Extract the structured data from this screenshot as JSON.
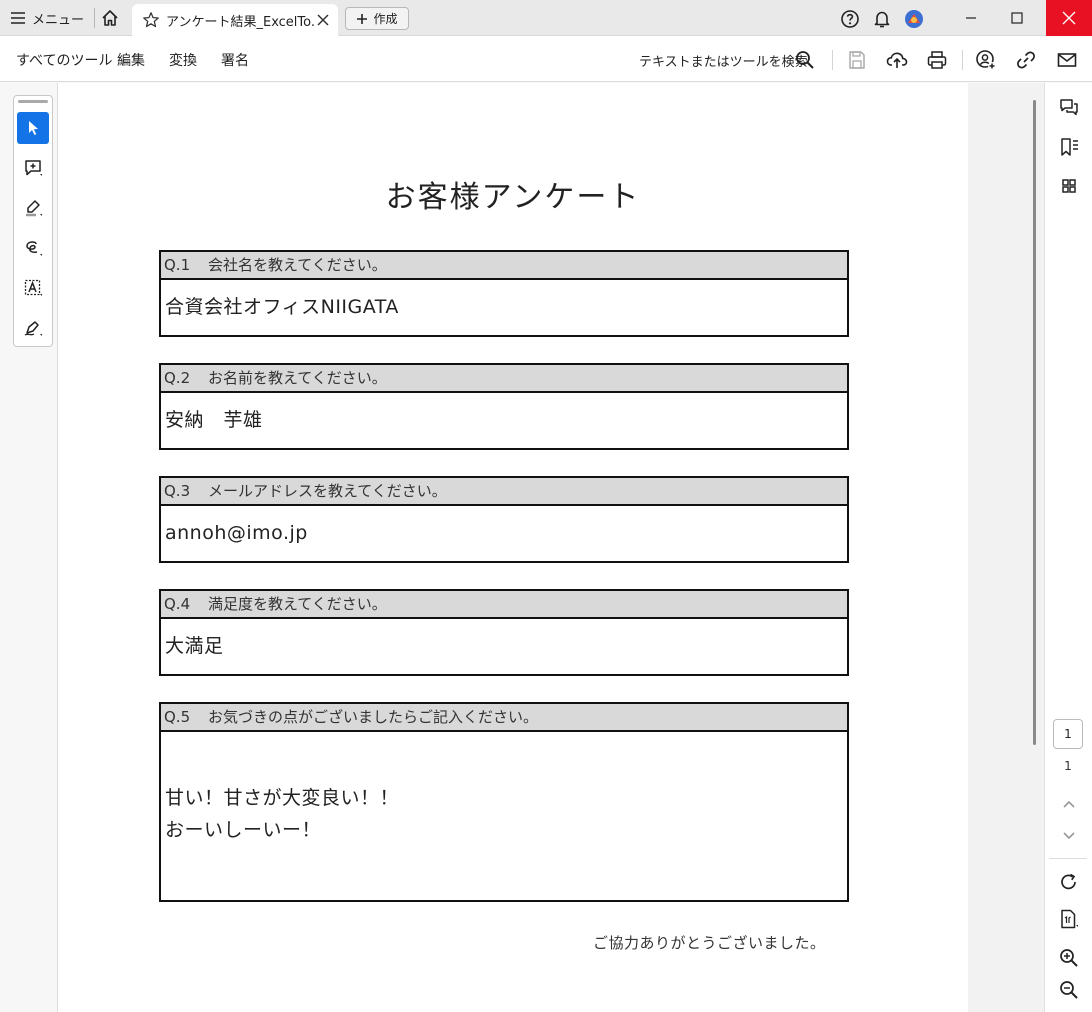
{
  "titlebar": {
    "menu_label": "メニュー",
    "tab_title": "アンケート結果_ExcelTo...",
    "create_label": "作成"
  },
  "toolbar": {
    "menus": [
      "すべてのツール",
      "編集",
      "変換",
      "署名"
    ],
    "search_label": "テキストまたはツールを検索"
  },
  "document": {
    "title": "お客様アンケート",
    "questions": [
      {
        "num": "Q.1",
        "text": "会社名を教えてください。",
        "answer": [
          "合資会社オフィスNIIGATA"
        ]
      },
      {
        "num": "Q.2",
        "text": "お名前を教えてください。",
        "answer": [
          "安納　芋雄"
        ]
      },
      {
        "num": "Q.3",
        "text": "メールアドレスを教えてください。",
        "answer": [
          "annoh@imo.jp"
        ]
      },
      {
        "num": "Q.4",
        "text": "満足度を教えてください。",
        "answer": [
          "大満足"
        ]
      },
      {
        "num": "Q.5",
        "text": "お気づきの点がございましたらご記入ください。",
        "answer": [
          "甘い！甘さが大変良い！！",
          "おーいしーいー！"
        ]
      }
    ],
    "thanks": "ご協力ありがとうございました。"
  },
  "navigation": {
    "current_page": "1",
    "total_pages": "1"
  },
  "colors": {
    "accent": "#1473e6",
    "close_button": "#e81123",
    "question_header_bg": "#d9d9d9"
  }
}
